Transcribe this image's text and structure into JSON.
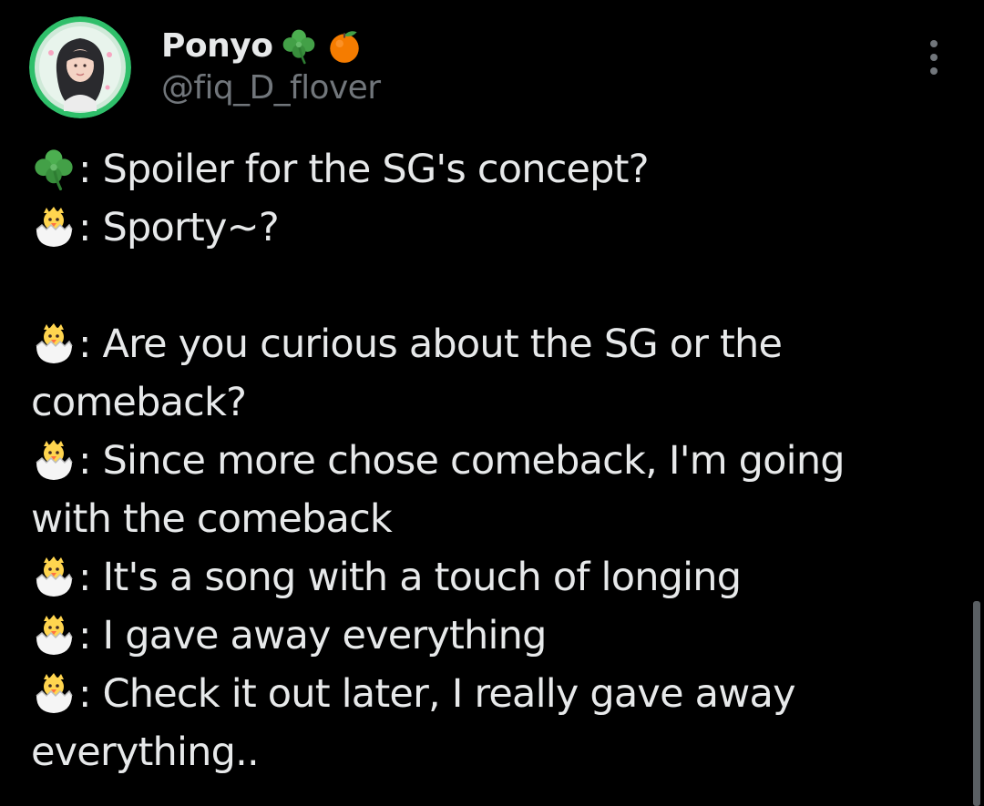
{
  "author": {
    "display_name": "Ponyo",
    "name_emojis": [
      "four-leaf-clover-icon",
      "tangerine-icon"
    ],
    "handle": "@fiq_D_flover"
  },
  "tweet": {
    "lines": [
      {
        "speaker_icon": "four-leaf-clover-icon",
        "text": ": Spoiler for the SG's concept?"
      },
      {
        "speaker_icon": "hatching-chick-icon",
        "text": ": Sporty~?"
      },
      {
        "speaker_icon": "hatching-chick-icon",
        "text": ": Are you curious about the SG or the"
      },
      {
        "text": "comeback?"
      },
      {
        "speaker_icon": "hatching-chick-icon",
        "text": ": Since more chose comeback, I'm going"
      },
      {
        "text": "with the comeback"
      },
      {
        "speaker_icon": "hatching-chick-icon",
        "text": ": It's a song with a touch of longing"
      },
      {
        "speaker_icon": "hatching-chick-icon",
        "text": ": I gave away everything"
      },
      {
        "speaker_icon": "hatching-chick-icon",
        "text": ": Check it out later, I really gave away"
      },
      {
        "text": "everything.."
      }
    ]
  },
  "colors": {
    "background": "#000000",
    "primary_text": "#e7e9ea",
    "secondary_text": "#71767b",
    "avatar_ring": "#2fbf6a"
  }
}
